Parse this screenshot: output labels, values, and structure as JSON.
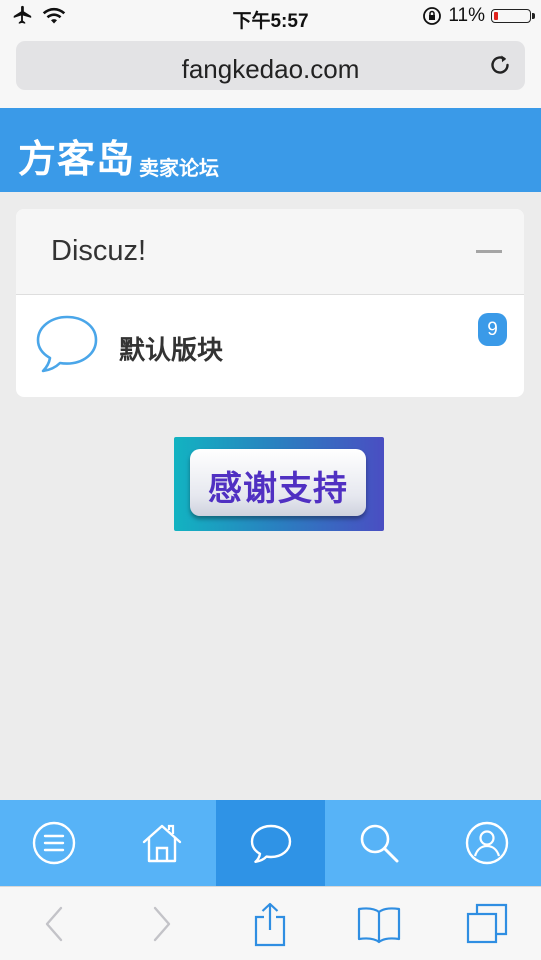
{
  "status_bar": {
    "time": "下午5:57",
    "battery_percent": "11%",
    "battery_level": 0.11
  },
  "browser": {
    "url": "fangkedao.com"
  },
  "header": {
    "logo_main": "方客岛",
    "logo_sub": "卖家论坛",
    "bg_color": "#3a9ae8"
  },
  "forum_group": {
    "title": "Discuz!",
    "forums": [
      {
        "name": "默认版块",
        "badge": "9"
      }
    ]
  },
  "banner": {
    "text": "感谢支持"
  },
  "bottom_nav": {
    "items": [
      "menu-icon",
      "home-icon",
      "chat-icon",
      "search-icon",
      "user-icon"
    ],
    "active_index": 2,
    "bg_color": "#57b3f7",
    "active_color": "#2f93e6"
  },
  "safari_toolbar": {
    "items": [
      "back-icon",
      "forward-icon",
      "share-icon",
      "bookmarks-icon",
      "tabs-icon"
    ]
  }
}
